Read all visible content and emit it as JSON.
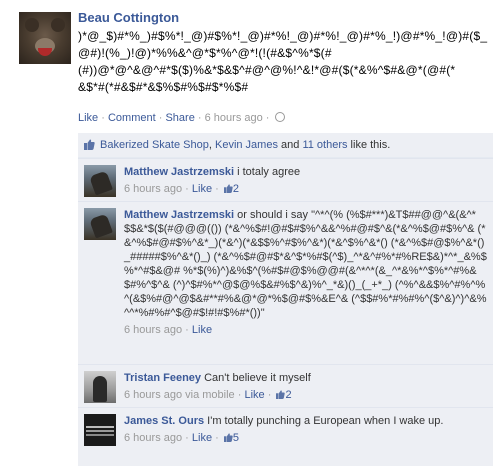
{
  "post": {
    "author": "Beau Cottington",
    "text_lines": [
      ")*@_$)#*%_)#$%*!_@)#$%*!_@)#*%!_@)#*%!_@)#*%_!)@#*%_!@)#($_",
      "@#)!(%_)!@)*%%&^@*$*%^@*!(!(#&$^%*$(#",
      "(#))@*@^&@^#*$($)%&*$&$^#@^@%!^&!*@#($(*&%^$#&@*(@#(*",
      "&$*#(*#&$#*&$%$#%$#$*%$#"
    ],
    "actions": {
      "like": "Like",
      "comment": "Comment",
      "share": "Share",
      "separator": "·",
      "timestamp": "6 hours ago"
    }
  },
  "likes": {
    "names_1": "Bakerized Skate Shop",
    "sep_1": ", ",
    "names_2": "Kevin James",
    "and": " and ",
    "others": "11 others",
    "suffix": " like this."
  },
  "comments": [
    {
      "name": "Matthew Jastrzemski",
      "text": "i totaly agree",
      "time": "6 hours ago",
      "like": "Like",
      "likes_count": "2"
    },
    {
      "name": "Matthew Jastrzemski",
      "text": "or should i say \"^*^(% (%$#***)&T$##@@^&(&^*$$&*$($(#@@@(()) (*&^%$#!@#$#$%^&&^%#@#$^&(*&^%$@#$%^& (*&^%$#@#$%^&*_)(*&^)(*&$$%^#$%^&*)(*&^$%^&*() (*&^%$#@$%^&*()_#####$%^&*()_) (*&^%$#@#$*&^$*%#$(^$)_^*&^#%*#%RE$&)*^*_&%$%*^#$&@# %*$(%)^)&%$^(%#$#@$%@@#(&^*^*(&_^*&%*^$%*^#%&$#%^$^& (^)^$#%*^@$@%$&#%$^&)%^_*&)()_(_+*_) (^%^&&$%^#%^%^(&$%#@^@$&#**#%&@*@*%$@#$%&E^& (^$$#%*#%#%^($^&)^)^&%^^*%#%#^$@#$!#!#$%#*())\"",
      "time": "6 hours ago",
      "like": "Like"
    },
    {
      "name": "Tristan Feeney",
      "text": "Can't believe it myself",
      "time": "6 hours ago via mobile",
      "like": "Like",
      "likes_count": "2"
    },
    {
      "name": "James St. Ours",
      "text": "I'm totally punching a European when I wake up.",
      "time": "6 hours ago",
      "like": "Like",
      "likes_count": "5"
    }
  ],
  "colors": {
    "link": "#3b5998",
    "comment_bg": "#edeff4",
    "meta": "#999999"
  },
  "icons": [
    "bear-avatar",
    "globe-icon",
    "thumbs-up-icon"
  ]
}
